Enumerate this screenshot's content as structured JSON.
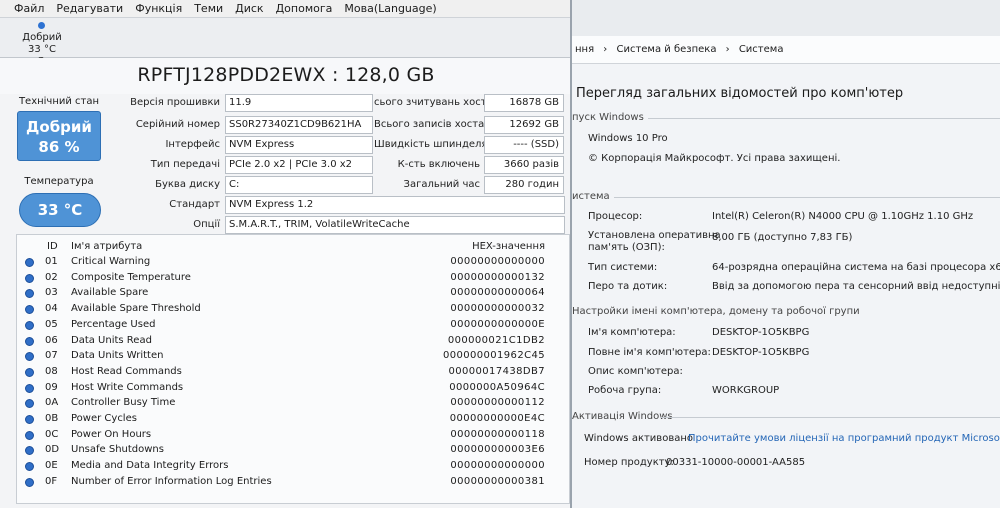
{
  "cdi": {
    "menu": [
      "Файл",
      "Редагувати",
      "Функція",
      "Теми",
      "Диск",
      "Допомога",
      "Мова(Language)"
    ],
    "drive_tab": {
      "status": "Добрий",
      "temp": "33 °C",
      "letter": "C:"
    },
    "model_title": "RPFTJ128PDD2EWX : 128,0 GB",
    "health_label": "Технічний стан",
    "health_status": "Добрий",
    "health_percent": "86 %",
    "temp_label": "Температура",
    "temp_value": "33 °C",
    "fields": {
      "firmware_label": "Версія прошивки",
      "firmware": "11.9",
      "serial_label": "Серійний номер",
      "serial": "SS0R27340Z1CD9B621HA",
      "interface_label": "Інтерфейс",
      "interface": "NVM Express",
      "transfer_label": "Тип передачі",
      "transfer": "PCIe 2.0 x2 | PCIe 3.0 x2",
      "letter_label": "Буква диску",
      "letter": "C:",
      "standard_label": "Стандарт",
      "standard": "NVM Express 1.2",
      "options_label": "Опції",
      "options": "S.M.A.R.T., TRIM, VolatileWriteCache",
      "host_reads_label": "сього зчитувань хоста",
      "host_reads": "16878 GB",
      "host_writes_label": "Всього записів хоста",
      "host_writes": "12692 GB",
      "rotation_label": "Швидкість шпинделя",
      "rotation": "---- (SSD)",
      "power_count_label": "К-сть включень",
      "power_count": "3660 разів",
      "power_hours_label": "Загальний час",
      "power_hours": "280 годин"
    },
    "smart": {
      "col_id": "ID",
      "col_name": "Ім'я атрибута",
      "col_hex": "HEX-значення",
      "rows": [
        {
          "id": "01",
          "name": "Critical Warning",
          "hex": "00000000000000"
        },
        {
          "id": "02",
          "name": "Composite Temperature",
          "hex": "00000000000132"
        },
        {
          "id": "03",
          "name": "Available Spare",
          "hex": "00000000000064"
        },
        {
          "id": "04",
          "name": "Available Spare Threshold",
          "hex": "00000000000032"
        },
        {
          "id": "05",
          "name": "Percentage Used",
          "hex": "0000000000000E"
        },
        {
          "id": "06",
          "name": "Data Units Read",
          "hex": "000000021C1DB2"
        },
        {
          "id": "07",
          "name": "Data Units Written",
          "hex": "000000001962C45"
        },
        {
          "id": "08",
          "name": "Host Read Commands",
          "hex": "00000017438DB7"
        },
        {
          "id": "09",
          "name": "Host Write Commands",
          "hex": "0000000A50964C"
        },
        {
          "id": "0A",
          "name": "Controller Busy Time",
          "hex": "00000000000112"
        },
        {
          "id": "0B",
          "name": "Power Cycles",
          "hex": "00000000000E4C"
        },
        {
          "id": "0C",
          "name": "Power On Hours",
          "hex": "00000000000118"
        },
        {
          "id": "0D",
          "name": "Unsafe Shutdowns",
          "hex": "000000000003E6"
        },
        {
          "id": "0E",
          "name": "Media and Data Integrity Errors",
          "hex": "00000000000000"
        },
        {
          "id": "0F",
          "name": "Number of Error Information Log Entries",
          "hex": "00000000000381"
        }
      ]
    }
  },
  "sys": {
    "breadcrumb": [
      "ння",
      "›",
      "Система й безпека",
      "›",
      "Система"
    ],
    "heading": "Перегляд загальних відомостей про комп'ютер",
    "edition_section": "пуск Windows",
    "edition": "Windows 10 Pro",
    "copyright": "© Корпорація Майкрософт. Усі права захищені.",
    "system_section": "истема",
    "cpu_label": "Процесор:",
    "cpu": "Intel(R) Celeron(R) N4000 CPU @ 1.10GHz   1.10 GHz",
    "ram_label_1": "Установлена оперативна",
    "ram_label_2": "пам'ять (ОЗП):",
    "ram": "8,00 ГБ (доступно 7,83 ГБ)",
    "type_label": "Тип системи:",
    "type": "64-розрядна операційна система на базі процесора x64",
    "pen_label": "Перо та дотик:",
    "pen": "Ввід за допомогою пера та сенсорний ввід недоступні на цьому",
    "naming_section": "Настройки імені комп'ютера, домену та робочої групи",
    "name_label": "Ім'я комп'ютера:",
    "name": "DESKTOP-1O5KBPG",
    "fullname_label": "Повне ім'я комп'ютера:",
    "fullname": "DESKTOP-1O5KBPG",
    "desc_label": "Опис комп'ютера:",
    "workgroup_label": "Робоча група:",
    "workgroup": "WORKGROUP",
    "activation_section": "Активація Windows",
    "activated": "Windows активовано",
    "license_link": "Прочитайте умови ліцензії на програмний продукт Microsoft",
    "product_id_label": "Номер продукту:",
    "product_id": "00331-10000-00001-AA585"
  }
}
